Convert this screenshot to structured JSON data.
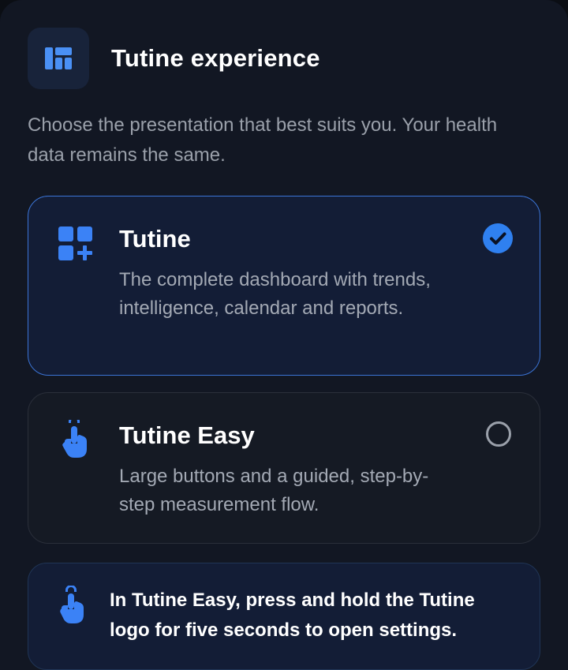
{
  "header": {
    "title": "Tutine experience",
    "icon": "layout-dashboard-icon"
  },
  "subtitle": "Choose the presentation that best suits you. Your health data remains the same.",
  "options": [
    {
      "title": "Tutine",
      "description": "The complete dashboard with trends, intelligence, calendar and reports.",
      "icon": "grid-add-icon",
      "selected": true
    },
    {
      "title": "Tutine Easy",
      "description": "Large buttons and a guided, step-by-step measurement flow.",
      "icon": "touch-hand-icon",
      "selected": false
    }
  ],
  "tip": {
    "text": "In Tutine Easy, press and hold the Tutine logo for five seconds to open settings.",
    "icon": "touch-hand-icon"
  },
  "colors": {
    "accent": "#2f80f0",
    "background": "#121723",
    "card_selected": "#131d36",
    "card_unselected": "#151a24"
  }
}
